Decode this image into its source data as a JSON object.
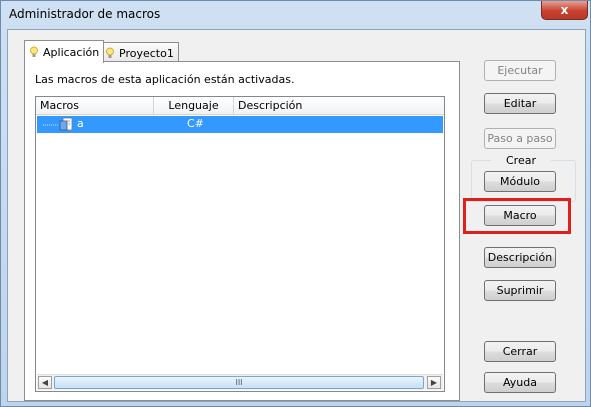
{
  "window": {
    "title": "Administrador de macros",
    "close_glyph": "x"
  },
  "tabs": [
    {
      "label": "Aplicación",
      "icon": "bulb-icon",
      "active": true
    },
    {
      "label": "Proyecto1",
      "icon": "bulb-icon",
      "active": false
    }
  ],
  "panel": {
    "message": "Las macros de esta aplicación están activadas."
  },
  "list": {
    "columns": [
      "Macros",
      "Lenguaje",
      "Descripción"
    ],
    "rows": [
      {
        "name": "a",
        "language": "C#",
        "description": "",
        "selected": true
      }
    ],
    "scroll_grip": "III"
  },
  "buttons": {
    "run": "Ejecutar",
    "edit": "Editar",
    "step": "Paso a paso",
    "create_group": "Crear",
    "module": "Módulo",
    "macro": "Macro",
    "description": "Descripción",
    "delete": "Suprimir",
    "close": "Cerrar",
    "help": "Ayuda"
  },
  "colors": {
    "selection": "#3399ff",
    "highlight_box": "#e0201e",
    "close_button": "#c8402e"
  }
}
